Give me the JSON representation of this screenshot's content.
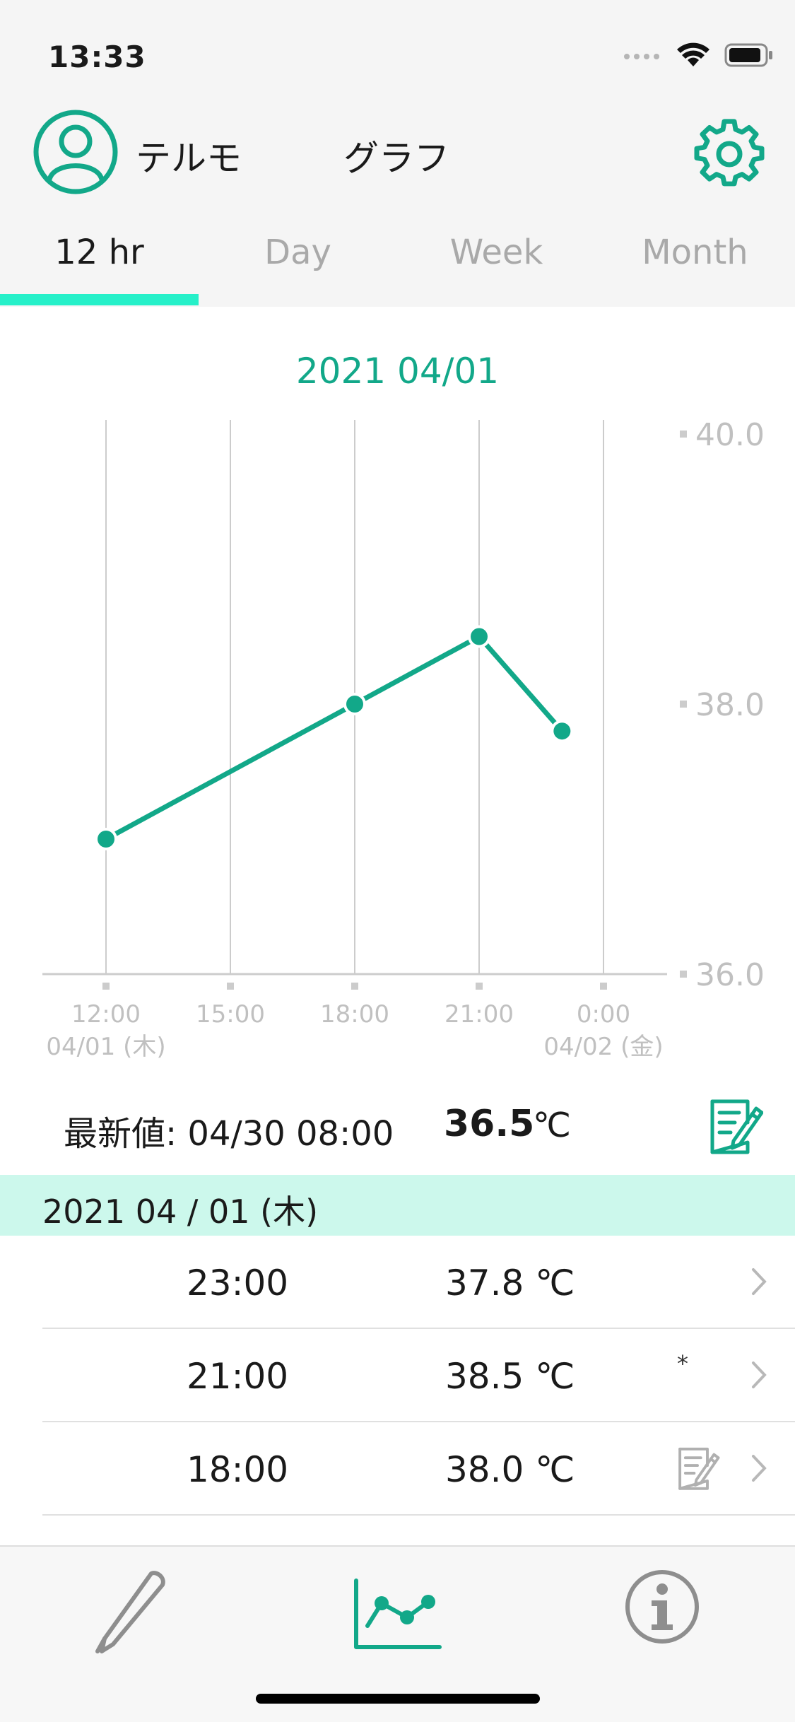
{
  "status_bar": {
    "time": "13:33"
  },
  "header": {
    "user_name": "テルモ",
    "title": "グラフ"
  },
  "tabs": [
    {
      "label": "12 hr",
      "active": true
    },
    {
      "label": "Day",
      "active": false
    },
    {
      "label": "Week",
      "active": false
    },
    {
      "label": "Month",
      "active": false
    }
  ],
  "colors": {
    "accent": "#12a889",
    "tab_indicator": "#26f0c9",
    "date_header_bg": "#ccf8ec",
    "grid": "#cccccc",
    "muted": "#c0c0c0"
  },
  "chart_data": {
    "type": "line",
    "title": "2021 04/01",
    "x_ticks": [
      {
        "time": "12:00",
        "date": "04/01 (木)"
      },
      {
        "time": "15:00",
        "date": ""
      },
      {
        "time": "18:00",
        "date": ""
      },
      {
        "time": "21:00",
        "date": ""
      },
      {
        "time": "0:00",
        "date": "04/02 (金)"
      }
    ],
    "x_range_hours": [
      12,
      24
    ],
    "y_ticks": [
      "40.0",
      "38.0",
      "36.0"
    ],
    "ylim": [
      36.0,
      40.0
    ],
    "series": [
      {
        "points": [
          {
            "x": 12,
            "y": 37.0
          },
          {
            "x": 18,
            "y": 38.0
          },
          {
            "x": 21,
            "y": 38.5
          },
          {
            "x": 23,
            "y": 37.8
          }
        ]
      }
    ]
  },
  "latest": {
    "label": "最新値: 04/30 08:00",
    "value": "36.5",
    "unit": "℃"
  },
  "list": {
    "date_header": "2021 04 / 01 (木)",
    "rows": [
      {
        "time": "23:00",
        "temp": "37.8 ℃",
        "mark": ""
      },
      {
        "time": "21:00",
        "temp": "38.5 ℃",
        "mark": "*"
      },
      {
        "time": "18:00",
        "temp": "38.0 ℃",
        "mark": "note"
      }
    ]
  },
  "tab_bar": {
    "items": [
      "thermometer-icon",
      "graph-icon",
      "info-icon"
    ]
  }
}
